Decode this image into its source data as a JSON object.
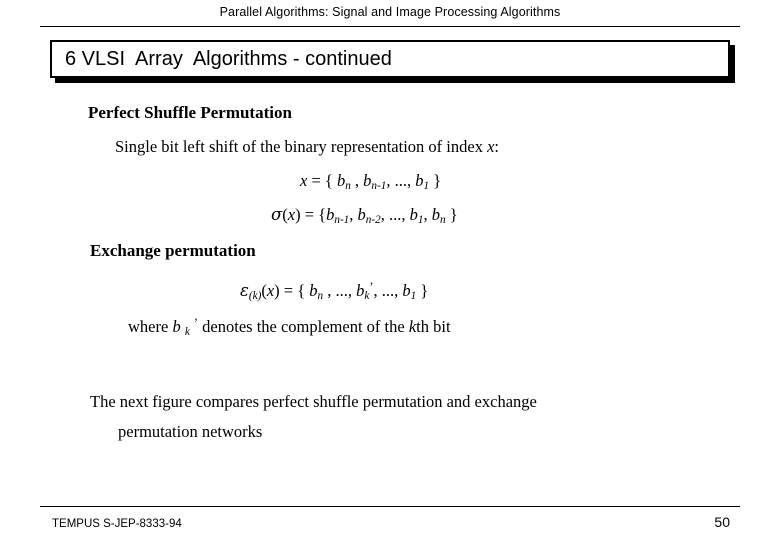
{
  "header": {
    "text": "Parallel Algorithms:  Signal and Image Processing Algorithms"
  },
  "title": {
    "text": "6 VLSI  Array  Algorithms - continued"
  },
  "body": {
    "heading1": "Perfect Shuffle Permutation",
    "sub1": "Single bit left shift of the binary representation of index x:",
    "eq1": "x = { bn , bn-1, ..., b1 }",
    "eq2": "σ(x) = {bn-1, bn-2, ..., b1, bn }",
    "heading2": "Exchange permutation",
    "eq3": "ε(k)(x) = { bn , ..., bk’, ..., b1 }",
    "eq4": "where b k ’ denotes the complement of the kth bit",
    "para1": "The next figure compares perfect shuffle permutation and exchange",
    "para2": "permutation networks"
  },
  "footer": {
    "left": "TEMPUS S-JEP-8333-94",
    "page": "50"
  }
}
